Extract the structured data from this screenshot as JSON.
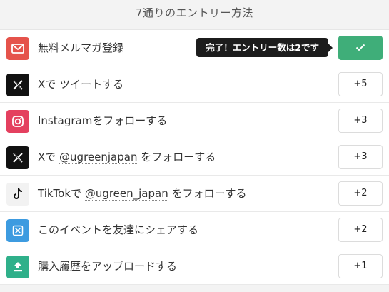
{
  "header": {
    "title": "7通りのエントリー方法"
  },
  "tooltip": {
    "text": "完了！エントリー数は2です"
  },
  "entries": [
    {
      "icon": "mail-icon",
      "icon_color": "#e5534b",
      "label": "無料メルマガ登録",
      "points": "✓",
      "completed": true
    },
    {
      "icon": "x-logo-icon",
      "icon_color": "#111111",
      "label_prefix": "X",
      "label_dotted": "で",
      "label_suffix": " ツイートする",
      "points": "+5"
    },
    {
      "icon": "instagram-icon",
      "icon_color": "#e4405f",
      "label": "Instagramをフォローする",
      "points": "+3"
    },
    {
      "icon": "x-logo-icon",
      "icon_color": "#111111",
      "label_prefix": "Xで ",
      "label_dotted": "@ugreenjapan",
      "label_suffix": " をフォローする",
      "points": "+3"
    },
    {
      "icon": "tiktok-icon",
      "icon_color": "#f2f2f2",
      "label_prefix": "TikTokで ",
      "label_dotted": "@ugreen_japan",
      "label_suffix": " をフォローする",
      "points": "+2"
    },
    {
      "icon": "share-event-icon",
      "icon_color": "#3d9be0",
      "label": "このイベントを友達にシェアする",
      "points": "+2"
    },
    {
      "icon": "upload-icon",
      "icon_color": "#2fb08a",
      "label": "購入履歴をアップロードする",
      "points": "+1"
    }
  ]
}
